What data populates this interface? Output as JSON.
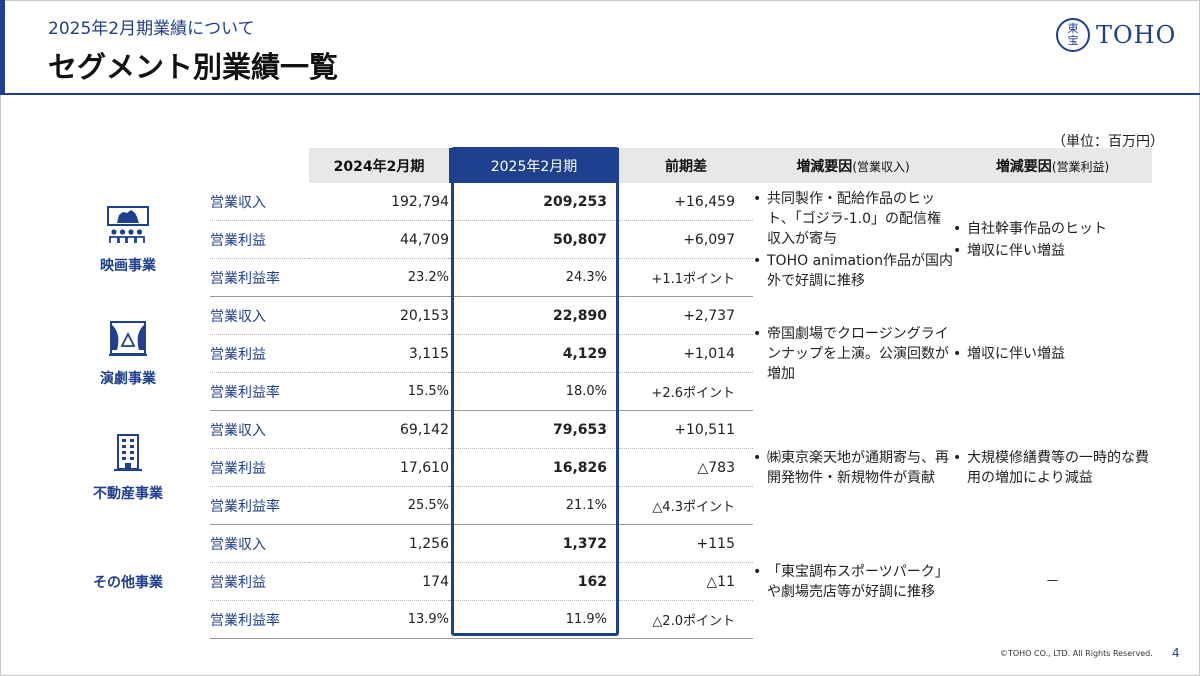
{
  "header": {
    "subtitle": "2025年2月期業績について",
    "title": "セグメント別業績一覧",
    "logo_text": "TOHO",
    "logo_seal_top": "東",
    "logo_seal_bottom": "宝"
  },
  "unit": "（単位：百万円）",
  "table": {
    "headers": [
      "2024年2月期",
      "2025年2月期",
      "前期差",
      "増減要因",
      "(営業収入)",
      "増減要因",
      "(営業利益)"
    ],
    "segments": [
      {
        "name": "映画事業",
        "icon": "movie-theater-icon",
        "rows": [
          {
            "label": "営業収入",
            "prev": "192,794",
            "curr": "209,253",
            "diff": "+16,459"
          },
          {
            "label": "営業利益",
            "prev": "44,709",
            "curr": "50,807",
            "diff": "+6,097"
          },
          {
            "label": "営業利益率",
            "prev": "23.2%",
            "curr": "24.3%",
            "diff": "+1.1ポイント"
          }
        ],
        "revenue_reasons": [
          "共同製作・配給作品のヒット、「ゴジラ-1.0」の配信権収入が寄与",
          "TOHO animation作品が国内外で好調に推移"
        ],
        "profit_reasons": [
          "自社幹事作品のヒット",
          "増収に伴い増益"
        ]
      },
      {
        "name": "演劇事業",
        "icon": "theater-stage-icon",
        "rows": [
          {
            "label": "営業収入",
            "prev": "20,153",
            "curr": "22,890",
            "diff": "+2,737"
          },
          {
            "label": "営業利益",
            "prev": "3,115",
            "curr": "4,129",
            "diff": "+1,014"
          },
          {
            "label": "営業利益率",
            "prev": "15.5%",
            "curr": "18.0%",
            "diff": "+2.6ポイント"
          }
        ],
        "revenue_reasons": [
          "帝国劇場でクロージングラインナップを上演。公演回数が増加"
        ],
        "profit_reasons": [
          "増収に伴い増益"
        ]
      },
      {
        "name": "不動産事業",
        "icon": "building-icon",
        "rows": [
          {
            "label": "営業収入",
            "prev": "69,142",
            "curr": "79,653",
            "diff": "+10,511"
          },
          {
            "label": "営業利益",
            "prev": "17,610",
            "curr": "16,826",
            "diff": "△783"
          },
          {
            "label": "営業利益率",
            "prev": "25.5%",
            "curr": "21.1%",
            "diff": "△4.3ポイント"
          }
        ],
        "revenue_reasons": [
          "㈱東京楽天地が通期寄与、再開発物件・新規物件が貢献"
        ],
        "profit_reasons": [
          "大規模修繕費等の一時的な費用の増加により減益"
        ]
      },
      {
        "name": "その他事業",
        "icon": "",
        "rows": [
          {
            "label": "営業収入",
            "prev": "1,256",
            "curr": "1,372",
            "diff": "+115"
          },
          {
            "label": "営業利益",
            "prev": "174",
            "curr": "162",
            "diff": "△11"
          },
          {
            "label": "営業利益率",
            "prev": "13.9%",
            "curr": "11.9%",
            "diff": "△2.0ポイント"
          }
        ],
        "revenue_reasons": [
          "「東宝調布スポーツパーク」や劇場売店等が好調に推移"
        ],
        "profit_dash": "－"
      }
    ]
  },
  "footer": {
    "copyright": "©TOHO CO., LTD. All Rights Reserved.",
    "page": "4"
  },
  "colors": {
    "brand": "#1f3f8f",
    "header_gray": "#e8e8e8"
  }
}
